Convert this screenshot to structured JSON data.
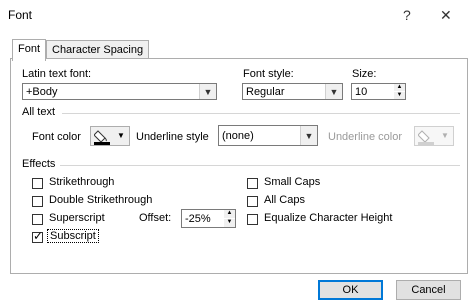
{
  "window": {
    "title": "Font",
    "help_label": "?",
    "close_label": "✕"
  },
  "tabs": [
    {
      "label": "Font",
      "selected": true
    },
    {
      "label": "Character Spacing",
      "selected": false
    }
  ],
  "font": {
    "latin_label": "Latin text font:",
    "latin_value": "+Body",
    "style_label": "Font style:",
    "style_value": "Regular",
    "size_label": "Size:",
    "size_value": "10"
  },
  "all_text": {
    "heading": "All text",
    "font_color_label": "Font color",
    "underline_style_label": "Underline style",
    "underline_style_value": "(none)",
    "underline_color_label": "Underline color"
  },
  "effects": {
    "heading": "Effects",
    "left": [
      {
        "label": "Strikethrough",
        "checked": false
      },
      {
        "label": "Double Strikethrough",
        "checked": false
      },
      {
        "label": "Superscript",
        "checked": false
      },
      {
        "label": "Subscript",
        "checked": true
      }
    ],
    "right": [
      {
        "label": "Small Caps",
        "checked": false
      },
      {
        "label": "All Caps",
        "checked": false
      },
      {
        "label": "Equalize Character Height",
        "checked": false
      }
    ],
    "offset_label": "Offset:",
    "offset_value": "-25%"
  },
  "buttons": {
    "ok": "OK",
    "cancel": "Cancel"
  },
  "colors": {
    "accent": "#0078d7",
    "font_color_swatch": "#000000"
  }
}
